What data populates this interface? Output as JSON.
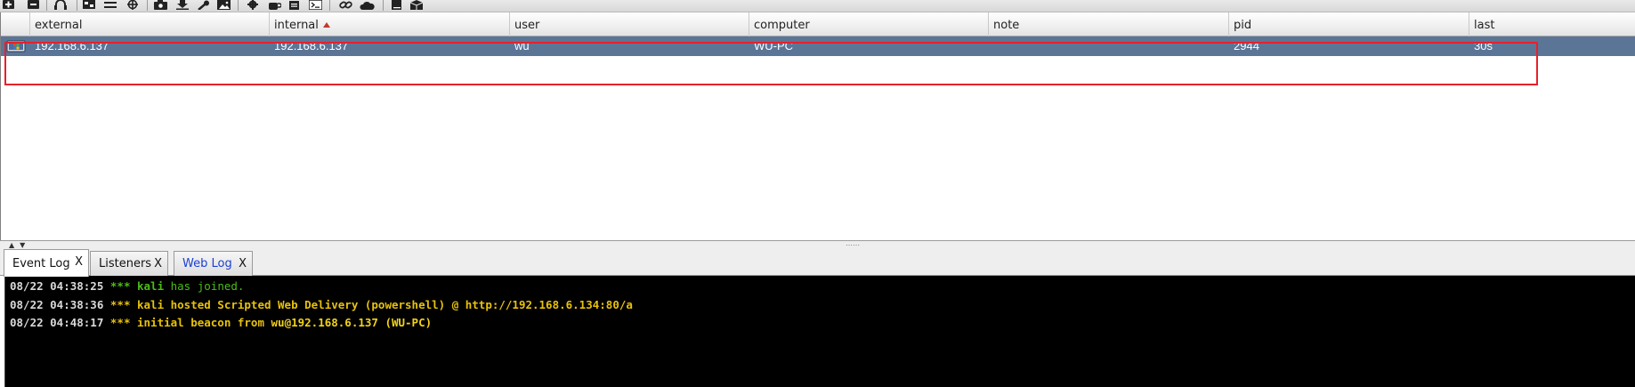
{
  "toolbar": {
    "icons": [
      "plus-icon",
      "minus-icon",
      "headphones-icon",
      "target-board-icon",
      "list-icon",
      "crosshair-icon",
      "camera-icon",
      "download-icon",
      "key-icon",
      "image-icon",
      "gear-icon",
      "coffee-icon",
      "clipboard-icon",
      "terminal-icon",
      "link-icon",
      "cloud-icon",
      "book-icon",
      "package-icon"
    ]
  },
  "table": {
    "columns": [
      {
        "key": "icon",
        "label": ""
      },
      {
        "key": "external",
        "label": "external"
      },
      {
        "key": "internal",
        "label": "internal",
        "sorted": "ascending"
      },
      {
        "key": "user",
        "label": "user"
      },
      {
        "key": "computer",
        "label": "computer"
      },
      {
        "key": "note",
        "label": "note"
      },
      {
        "key": "pid",
        "label": "pid"
      },
      {
        "key": "last",
        "label": "last"
      }
    ],
    "rows": [
      {
        "external": "192.168.6.137",
        "internal": "192.168.6.137",
        "user": "wu",
        "computer": "WU-PC",
        "note": "",
        "pid": "2944",
        "last": "30s",
        "selected": true
      }
    ]
  },
  "tabs": [
    {
      "label": "Event Log",
      "close": "X",
      "active": true
    },
    {
      "label": "Listeners",
      "close": "X",
      "active": false
    },
    {
      "label": "Web Log",
      "close": "X",
      "active": false
    }
  ],
  "log": [
    {
      "ts": "08/22 04:38:25",
      "stars": "***",
      "parts": [
        {
          "text": " kali",
          "style": "bold-green"
        },
        {
          "text": " has joined.",
          "style": "green"
        }
      ]
    },
    {
      "ts": "08/22 04:38:36",
      "stars": "***",
      "parts": [
        {
          "text": " kali hosted Scripted Web Delivery (powershell) @ http://192.168.6.134:80/a",
          "style": "yellow"
        }
      ]
    },
    {
      "ts": "08/22 04:48:17",
      "stars": "***",
      "parts": [
        {
          "text": " initial beacon from ",
          "style": "yellow"
        },
        {
          "text": "wu@192.168.6.137 (WU-PC)",
          "style": "bold-yellow"
        }
      ]
    }
  ],
  "colors": {
    "selected_row": "#5b7597",
    "highlight_box": "#e8202a",
    "console_bg": "#000000",
    "log_green": "#4cbb17",
    "log_yellow": "#e8c10b"
  }
}
